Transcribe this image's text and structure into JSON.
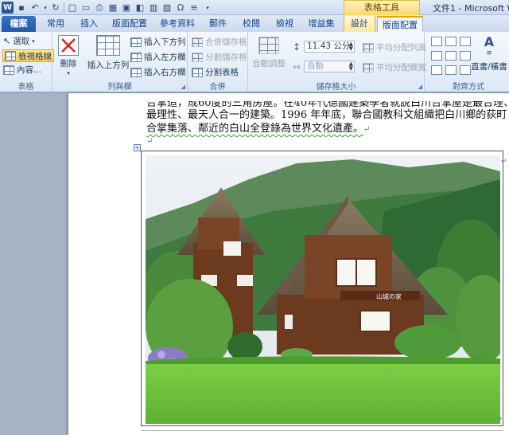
{
  "window": {
    "tool_context_label": "表格工具",
    "doc_title": "文件1 - Microsoft Wo"
  },
  "tabs": {
    "file": "檔案",
    "home": "常用",
    "insert": "插入",
    "page_layout": "版面配置",
    "references": "參考資料",
    "mailings": "郵件",
    "review": "校閱",
    "view": "檢視",
    "addins": "增益集",
    "design": "設計",
    "layout": "版面配置"
  },
  "ribbon": {
    "table": {
      "label": "表格",
      "select": "選取",
      "view_gridlines": "檢視格線",
      "properties": "內容..."
    },
    "rows_columns": {
      "label": "列與欄",
      "delete": "刪除",
      "insert_above": "插入上方列",
      "insert_below": "插入下方列",
      "insert_left": "插入左方欄",
      "insert_right": "插入右方欄"
    },
    "merge": {
      "label": "合併",
      "merge_cells": "合併儲存格",
      "split_cells": "分割儲存格",
      "split_table": "分割表格"
    },
    "cell_size": {
      "label": "儲存格大小",
      "autofit": "自動調整",
      "height_value": "11.43 公分",
      "width_value": "自動",
      "distribute_rows": "平均分配列高",
      "distribute_cols": "平均分配欄寬"
    },
    "alignment": {
      "label": "對齊方式",
      "text_direction": "直書/橫書"
    }
  },
  "document": {
    "line1": "合掌造，成60度的三角房屋。在40年代德國建築學者就說白川合掌屋是最合理、",
    "line2": "最理性、最天人合一的建築。1996 年年底，聯合國教科文組織把白川鄉的荻町",
    "line3": "合掌集落、鄰近的白山全登錄為世界文化遺產。",
    "signboard_text": "山城の家",
    "return_mark": "↵",
    "table_move_glyph": "+"
  },
  "colors": {
    "accent": "#2b579a",
    "tool_context": "#f7d86a",
    "grass": "#6fc23c",
    "wood": "#6b3a1f"
  }
}
